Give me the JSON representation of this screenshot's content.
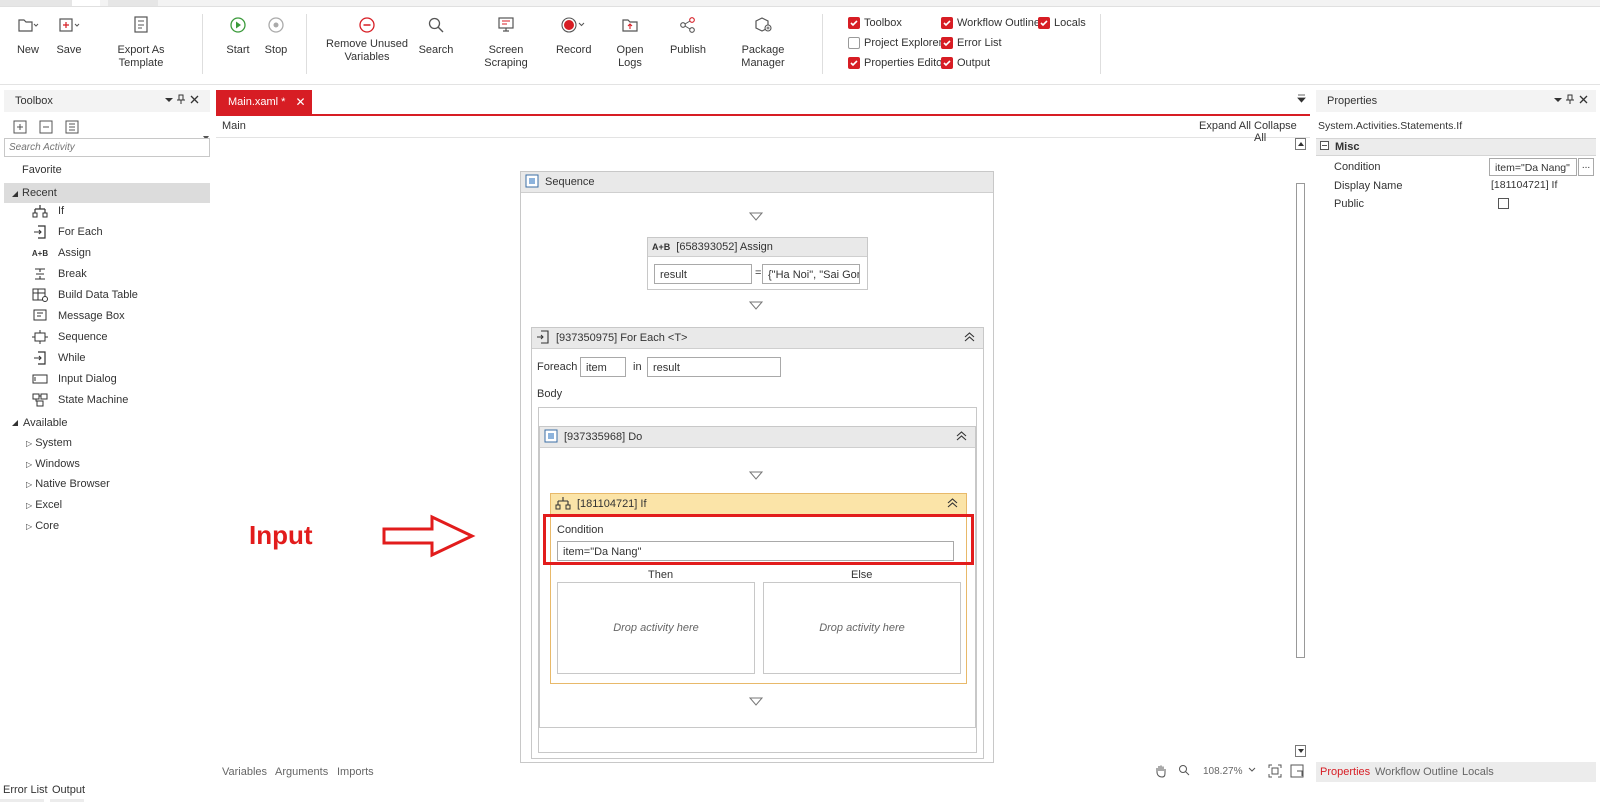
{
  "ribbon": {
    "new": "New",
    "save": "Save",
    "export_template": "Export As Template",
    "start": "Start",
    "stop": "Stop",
    "remove_unused_line1": "Remove Unused",
    "remove_unused_line2": "Variables",
    "search": "Search",
    "screen_scraping": "Screen Scraping",
    "record": "Record",
    "open_logs": "Open Logs",
    "publish": "Publish",
    "package_manager": "Package Manager",
    "panels": {
      "toolbox": {
        "label": "Toolbox",
        "checked": true
      },
      "project_explorer": {
        "label": "Project Explorer",
        "checked": false
      },
      "properties_editor": {
        "label": "Properties Editor",
        "checked": true
      },
      "workflow_outline": {
        "label": "Workflow Outline",
        "checked": true
      },
      "error_list": {
        "label": "Error List",
        "checked": true
      },
      "output": {
        "label": "Output",
        "checked": true
      },
      "locals": {
        "label": "Locals",
        "checked": true
      }
    },
    "accent": "#d71d24"
  },
  "toolbox": {
    "title": "Toolbox",
    "search_placeholder": "Search Activity",
    "favorite": "Favorite",
    "recent": "Recent",
    "recent_items": [
      "If",
      "For Each",
      "Assign",
      "Break",
      "Build Data Table",
      "Message Box",
      "Sequence",
      "While",
      "Input Dialog",
      "State Machine"
    ],
    "available": "Available",
    "available_items": [
      "System",
      "Windows",
      "Native Browser",
      "Excel",
      "Core"
    ]
  },
  "designer": {
    "tab_label": "Main.xaml *",
    "breadcrumb": "Main",
    "expand_all": "Expand All",
    "collapse_all": "Collapse All",
    "sequence_title": "Sequence",
    "assign_title": "[658393052] Assign",
    "assign_to": "result",
    "assign_eq": "=",
    "assign_value": "{\"Ha Noi\", \"Sai Gon\"",
    "foreach_title": "[937350975] For Each <T>",
    "foreach_label": "Foreach",
    "foreach_var": "item",
    "foreach_in": "in",
    "foreach_collection": "result",
    "body_label": "Body",
    "do_title": "[937335968] Do",
    "if_title": "[181104721] If",
    "condition_label": "Condition",
    "condition_value": "item=\"Da Nang\"",
    "then_label": "Then",
    "else_label": "Else",
    "drop_then": "Drop activity here",
    "drop_else": "Drop activity here",
    "annotation": "Input",
    "annotation_color": "#e21c1c",
    "bottom_tabs": [
      "Variables",
      "Arguments",
      "Imports"
    ],
    "zoom": "108.27%"
  },
  "properties": {
    "title": "Properties",
    "type_name": "System.Activities.Statements.If",
    "section": "Misc",
    "rows": [
      {
        "name": "Condition",
        "value": "item=\"Da Nang\""
      },
      {
        "name": "Display Name",
        "value": "[181104721] If"
      },
      {
        "name": "Public",
        "value": ""
      }
    ],
    "ellipsis": "...",
    "bottom_tabs": [
      "Properties",
      "Workflow Outline",
      "Locals"
    ]
  },
  "statusbar": {
    "tabs": [
      "Error List",
      "Output"
    ]
  }
}
